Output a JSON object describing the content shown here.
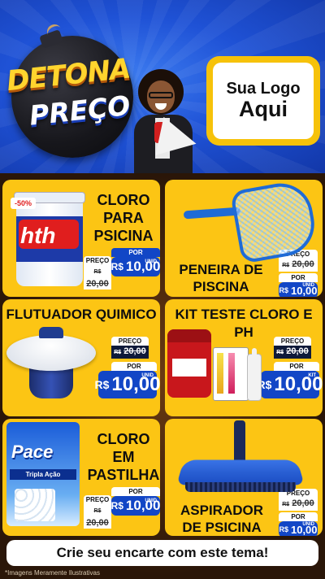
{
  "header": {
    "brand_line1": "DETONA",
    "brand_line2": "PREÇO",
    "logo_placeholder_line1": "Sua Logo",
    "logo_placeholder_line2": "Aqui",
    "colors": {
      "background": "#1f52d6",
      "accent": "#f6c20a"
    }
  },
  "products": [
    {
      "title_lines": [
        "CLORO",
        "PARA",
        "PSICINA"
      ],
      "badge": "-50%",
      "old_label": "PREÇO",
      "old_currency": "R$",
      "old_price": "20,00",
      "new_label": "POR",
      "new_currency": "R$",
      "new_price": "10,00",
      "unit": "UNID",
      "brand_text": "hth",
      "image_icon": "chlorine-bucket-icon"
    },
    {
      "title_lines": [
        "PENEIRA DE",
        "PISCINA"
      ],
      "old_label": "PREÇO",
      "old_currency": "R$",
      "old_price": "20,00",
      "new_label": "POR",
      "new_currency": "R$",
      "new_price": "10,00",
      "unit": "UNID",
      "image_icon": "pool-skimmer-net-icon"
    },
    {
      "title_lines": [
        "FLUTUADOR QUIMICO"
      ],
      "old_label": "PREÇO",
      "old_currency": "R$",
      "old_price": "20,00",
      "new_label": "POR",
      "new_currency": "R$",
      "new_price": "10,00",
      "unit": "UNID",
      "image_icon": "chemical-floater-icon"
    },
    {
      "title_lines": [
        "KIT TESTE CLORO E PH"
      ],
      "old_label": "PREÇO",
      "old_currency": "R$",
      "old_price": "20,00",
      "new_label": "POR",
      "new_currency": "R$",
      "new_price": "10,00",
      "unit": "KIT",
      "image_icon": "test-kit-icon"
    },
    {
      "title_lines": [
        "CLORO",
        "EM",
        "PASTILHA"
      ],
      "old_label": "PREÇO",
      "old_currency": "R$",
      "old_price": "20,00",
      "new_label": "POR",
      "new_currency": "R$",
      "new_price": "10,00",
      "unit": "UNID",
      "brand_text": "Pace",
      "brand_sub": "Tripla Ação",
      "image_icon": "chlorine-tablets-pack-icon"
    },
    {
      "title_lines": [
        "ASPIRADOR",
        "DE PSICINA"
      ],
      "old_label": "PREÇO",
      "old_currency": "R$",
      "old_price": "20,00",
      "new_label": "POR",
      "new_currency": "R$",
      "new_price": "10,00",
      "unit": "UNID",
      "image_icon": "pool-vacuum-head-icon"
    }
  ],
  "cta_text": "Crie seu encarte com este tema!",
  "disclaimer": "*Imagens Meramente Ilustrativas"
}
